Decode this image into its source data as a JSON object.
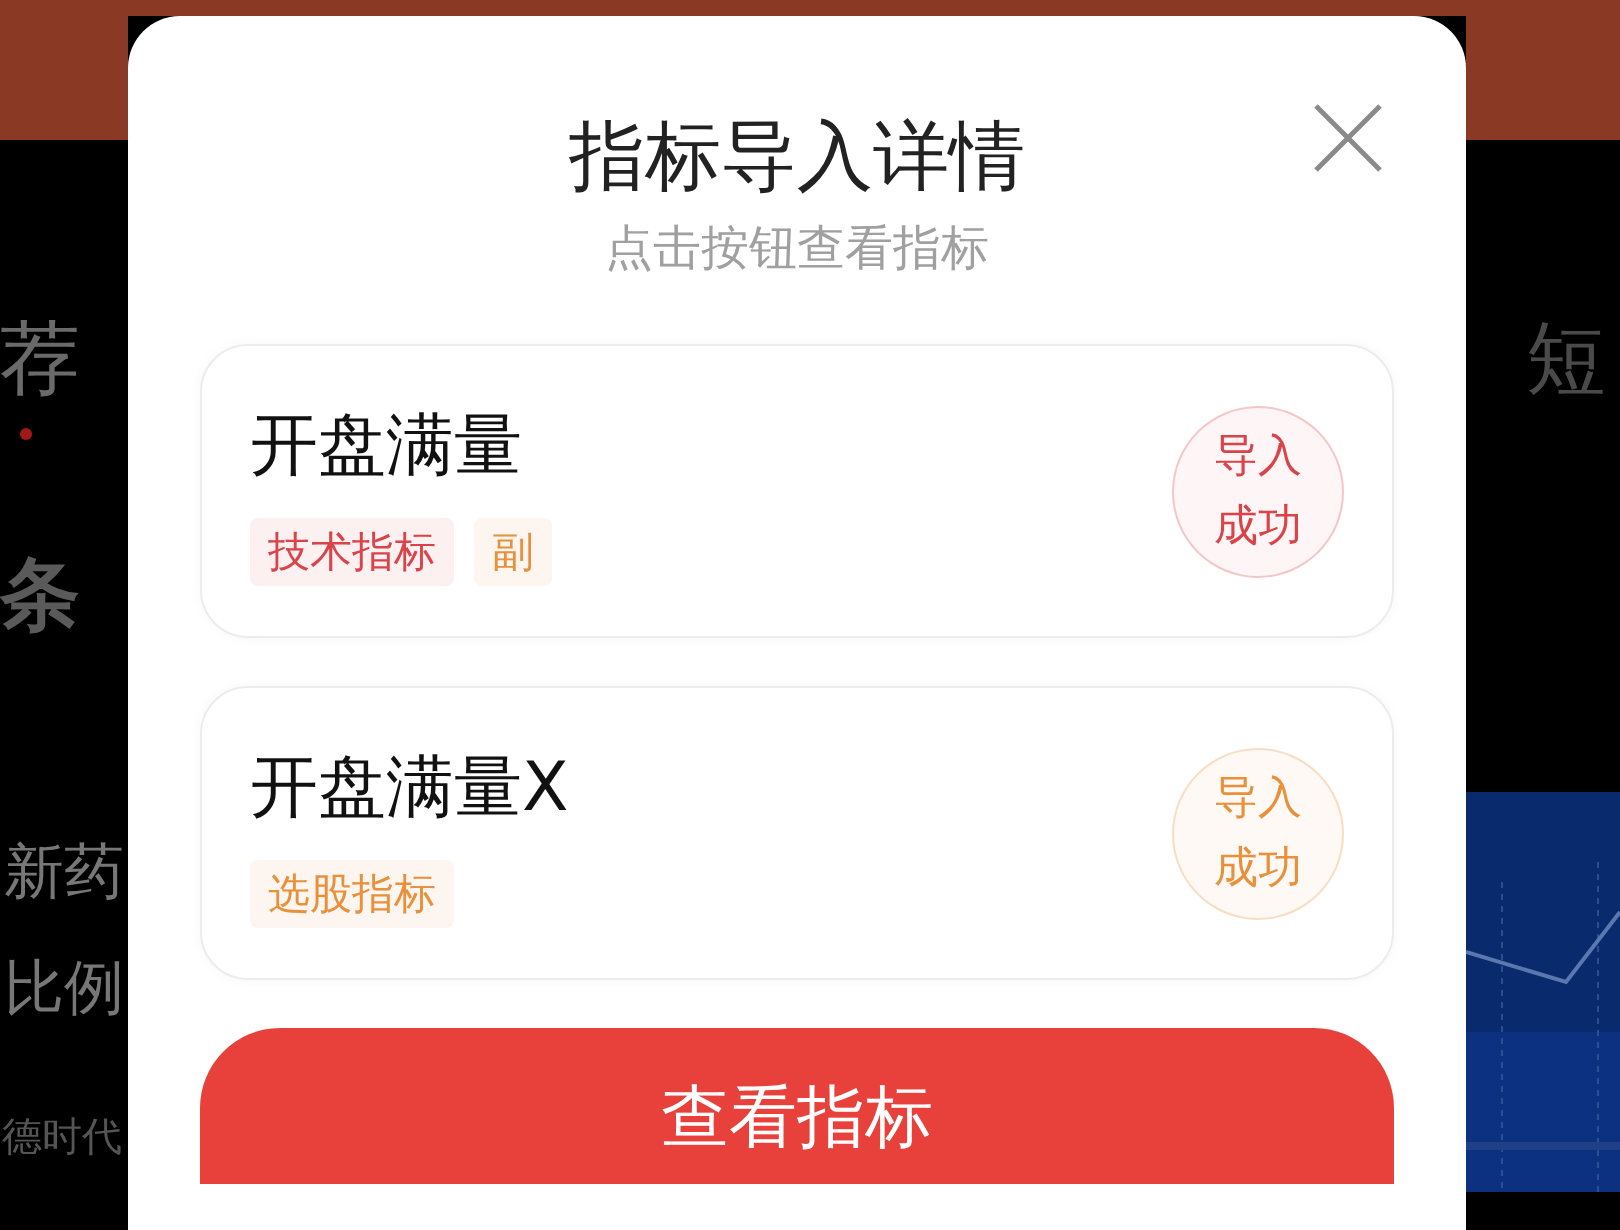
{
  "background": {
    "left": [
      {
        "kind": "tab",
        "text": "荐",
        "selected": true
      },
      {
        "kind": "heading",
        "text": "条"
      },
      {
        "kind": "headline",
        "text": "新药"
      },
      {
        "kind": "headline",
        "text": "比例"
      },
      {
        "kind": "caption",
        "text": "德时代"
      }
    ],
    "right": [
      {
        "kind": "tab",
        "text": "短",
        "selected": false
      },
      {
        "kind": "picture"
      }
    ]
  },
  "dialog": {
    "title": "指标导入详情",
    "subtitle": "点击按钮查看指标",
    "items": [
      {
        "name": "开盘满量",
        "tags": [
          {
            "label": "技术指标",
            "color": "#d9434a"
          },
          {
            "label": "副",
            "color": "#e8903a"
          }
        ],
        "status": {
          "label": "导入成功",
          "color": "#d9434a"
        }
      },
      {
        "name": "开盘满量X",
        "tags": [
          {
            "label": "选股指标",
            "color": "#e8903a"
          }
        ],
        "status": {
          "label": "导入成功",
          "color": "#e8903a"
        }
      }
    ],
    "button": "查看指标"
  }
}
